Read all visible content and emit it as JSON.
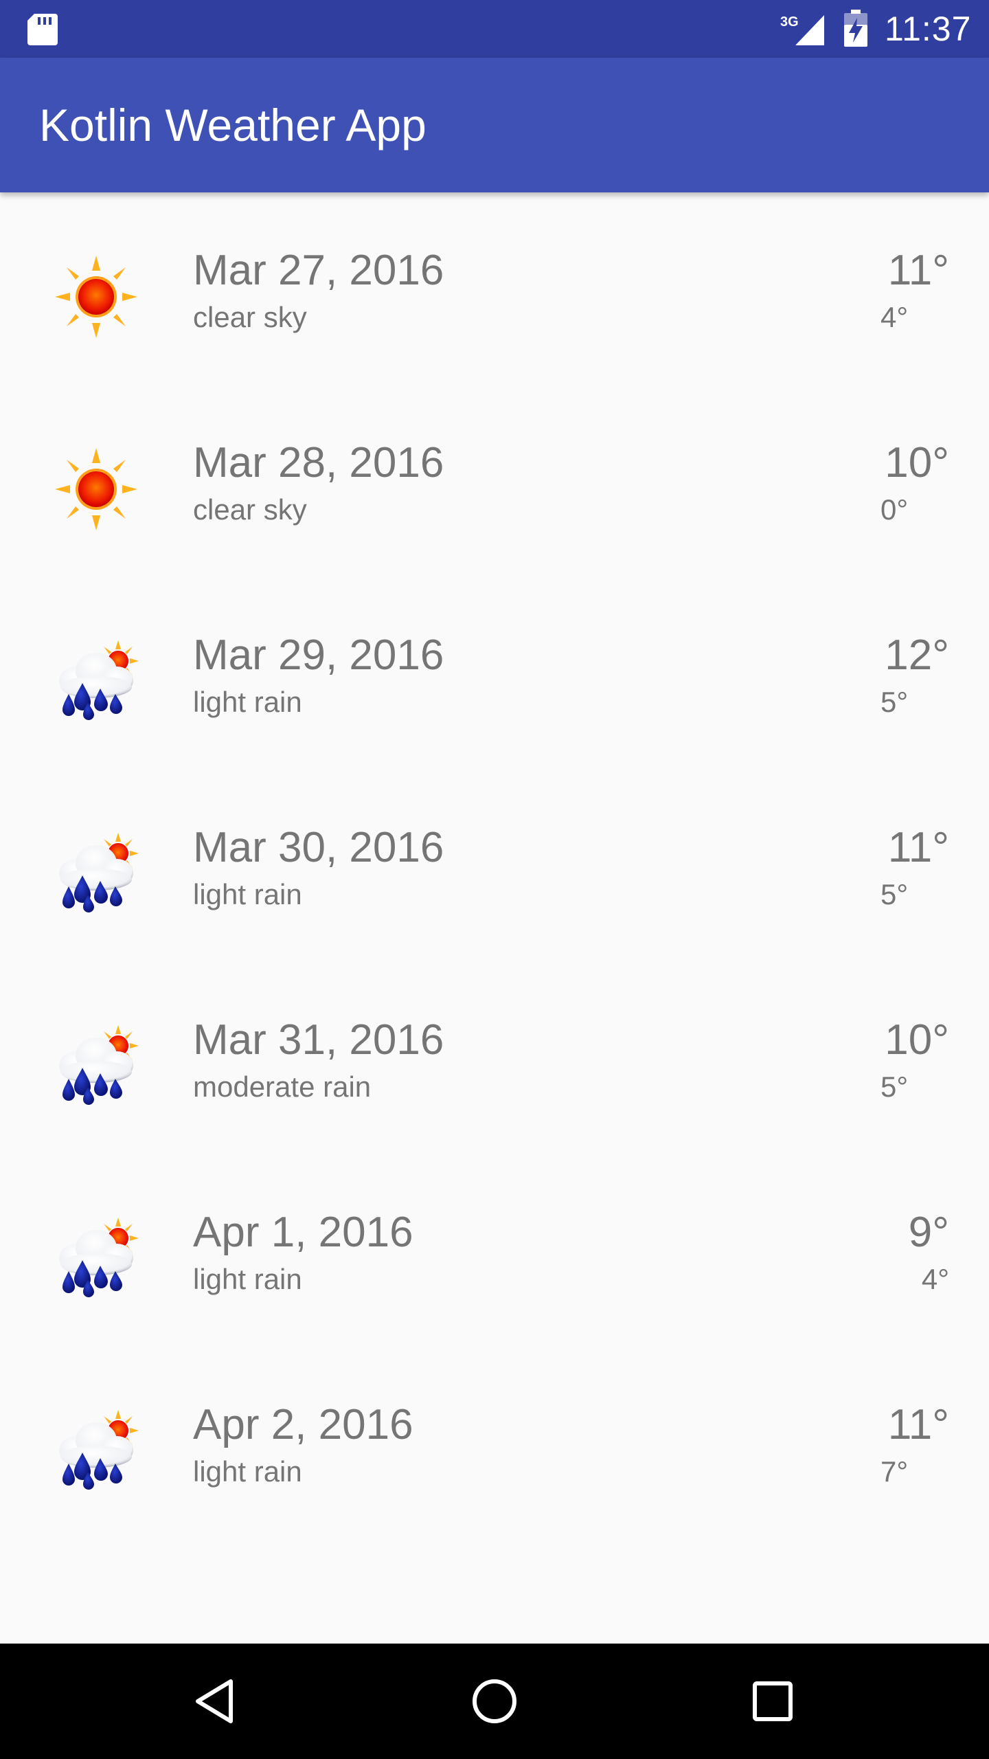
{
  "status_bar": {
    "time": "11:37",
    "network": "3G",
    "icons": [
      "sd-card-icon",
      "signal-3g-icon",
      "battery-charging-icon"
    ]
  },
  "app_bar": {
    "title": "Kotlin Weather App",
    "color": "#3f51b5",
    "status_color": "#303f9f"
  },
  "forecast": [
    {
      "date": "Mar 27, 2016",
      "description": "clear sky",
      "high": "11°",
      "low": "4°",
      "icon": "sun-icon"
    },
    {
      "date": "Mar 28, 2016",
      "description": "clear sky",
      "high": "10°",
      "low": "0°",
      "icon": "sun-icon"
    },
    {
      "date": "Mar 29, 2016",
      "description": "light rain",
      "high": "12°",
      "low": "5°",
      "icon": "rain-cloud-sun-icon"
    },
    {
      "date": "Mar 30, 2016",
      "description": "light rain",
      "high": "11°",
      "low": "5°",
      "icon": "rain-cloud-sun-icon"
    },
    {
      "date": "Mar 31, 2016",
      "description": "moderate rain",
      "high": "10°",
      "low": "5°",
      "icon": "rain-cloud-sun-icon"
    },
    {
      "date": "Apr 1, 2016",
      "description": "light rain",
      "high": "9°",
      "low": "4°",
      "icon": "rain-cloud-sun-icon"
    },
    {
      "date": "Apr 2, 2016",
      "description": "light rain",
      "high": "11°",
      "low": "7°",
      "icon": "rain-cloud-sun-icon"
    }
  ],
  "nav_bar": {
    "buttons": [
      "back-icon",
      "home-icon",
      "recents-icon"
    ]
  }
}
